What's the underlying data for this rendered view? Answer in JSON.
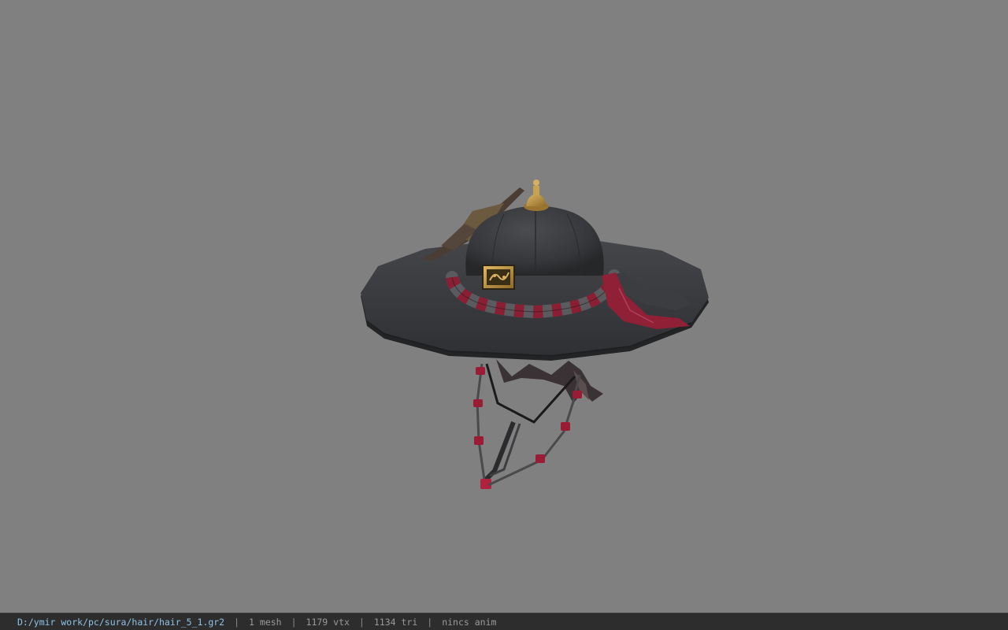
{
  "viewer": {
    "background": "#808080",
    "model": "hat-model"
  },
  "statusbar": {
    "path": "D:/ymir work/pc/sura/hair/hair_5_1.gr2",
    "separator": "|",
    "mesh": "1 mesh",
    "vertices": "1179 vtx",
    "triangles": "1134 tri",
    "anim": "nincs anim"
  },
  "colors": {
    "path_text": "#8ec3e6",
    "status_text": "#9a9a9a",
    "status_bg": "#2d2d2d",
    "hat_dark": "#3a3b3e",
    "cord_red": "#8a1f33",
    "ornament_gold": "#c29a4a"
  }
}
